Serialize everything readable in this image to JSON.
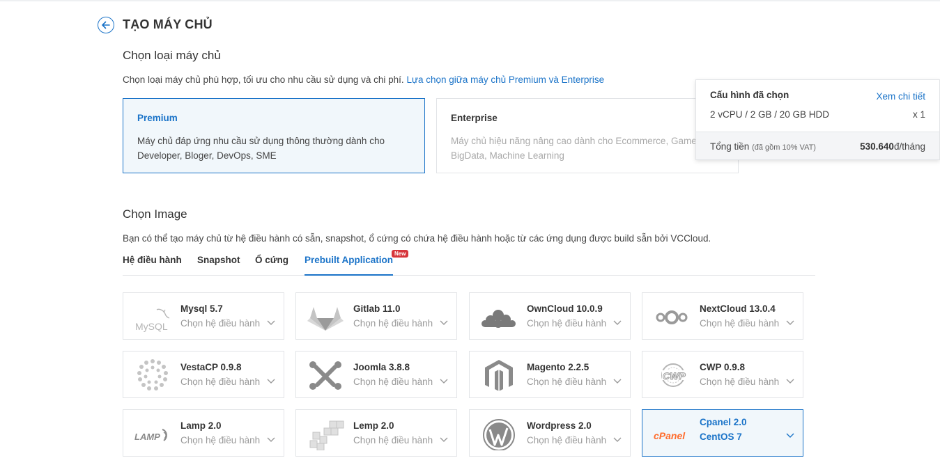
{
  "page": {
    "title": "TẠO MÁY CHỦ"
  },
  "server_type": {
    "heading": "Chọn loại máy chủ",
    "description": "Chọn loại máy chủ phù hợp, tối ưu cho nhu cầu sử dụng và chi phí.",
    "compare_link": "Lựa chọn giữa máy chủ Premium và Enterprise",
    "options": [
      {
        "title": "Premium",
        "line1": "Máy chủ đáp ứng nhu cầu sử dụng thông thường dành cho",
        "line2": "Developer, Bloger, DevOps, SME",
        "selected": true
      },
      {
        "title": "Enterprise",
        "line1": "Máy chủ hiệu năng nâng cao dành cho Ecommerce, Game,",
        "line2": "BigData, Machine Learning",
        "selected": false
      }
    ]
  },
  "image": {
    "heading": "Chọn Image",
    "description": "Bạn có thể tạo máy chủ từ hệ điều hành có sẵn, snapshot, ổ cứng có chứa hệ điều hành hoặc từ các ứng dụng được build sẵn bởi VCCloud.",
    "tabs": [
      {
        "label": "Hệ điều hành"
      },
      {
        "label": "Snapshot"
      },
      {
        "label": "Ổ cứng"
      },
      {
        "label": "Prebuilt Application",
        "active": true
      }
    ],
    "new_badge": "New",
    "apps": [
      {
        "name": "Mysql 5.7",
        "os": "Chọn hệ điều hành",
        "logo": "mysql-logo"
      },
      {
        "name": "Gitlab 11.0",
        "os": "Chọn hệ điều hành",
        "logo": "gitlab-logo"
      },
      {
        "name": "OwnCloud 10.0.9",
        "os": "Chọn hệ điều hành",
        "logo": "owncloud-logo"
      },
      {
        "name": "NextCloud 13.0.4",
        "os": "Chọn hệ điều hành",
        "logo": "nextcloud-logo"
      },
      {
        "name": "VestaCP 0.9.8",
        "os": "Chọn hệ điều hành",
        "logo": "vestacp-logo"
      },
      {
        "name": "Joomla 3.8.8",
        "os": "Chọn hệ điều hành",
        "logo": "joomla-logo"
      },
      {
        "name": "Magento 2.2.5",
        "os": "Chọn hệ điều hành",
        "logo": "magento-logo"
      },
      {
        "name": "CWP 0.9.8",
        "os": "Chọn hệ điều hành",
        "logo": "cwp-logo"
      },
      {
        "name": "Lamp 2.0",
        "os": "Chọn hệ điều hành",
        "logo": "lamp-logo"
      },
      {
        "name": "Lemp 2.0",
        "os": "Chọn hệ điều hành",
        "logo": "lemp-logo"
      },
      {
        "name": "Wordpress 2.0",
        "os": "Chọn hệ điều hành",
        "logo": "wordpress-logo"
      },
      {
        "name": "Cpanel 2.0",
        "os": "CentOS 7",
        "logo": "cpanel-logo",
        "selected": true
      }
    ],
    "logo_text": {
      "mysql": "MySQL",
      "lamp": "LAMP",
      "cwp": "CWP",
      "cpanel": "cPanel"
    }
  },
  "summary": {
    "title": "Cấu hình đã chọn",
    "detail_link": "Xem chi tiết",
    "config": "2 vCPU / 2 GB / 20 GB HDD",
    "quantity": "x 1",
    "total_label": "Tổng tiền",
    "vat_note": "(đã gồm 10% VAT)",
    "price": "530.640",
    "price_unit": "đ/tháng"
  },
  "colors": {
    "accent": "#1a73c8",
    "selected_bg": "#f1f7fb",
    "badge": "#d7353b",
    "logo_gray": "#b5b5b5"
  }
}
